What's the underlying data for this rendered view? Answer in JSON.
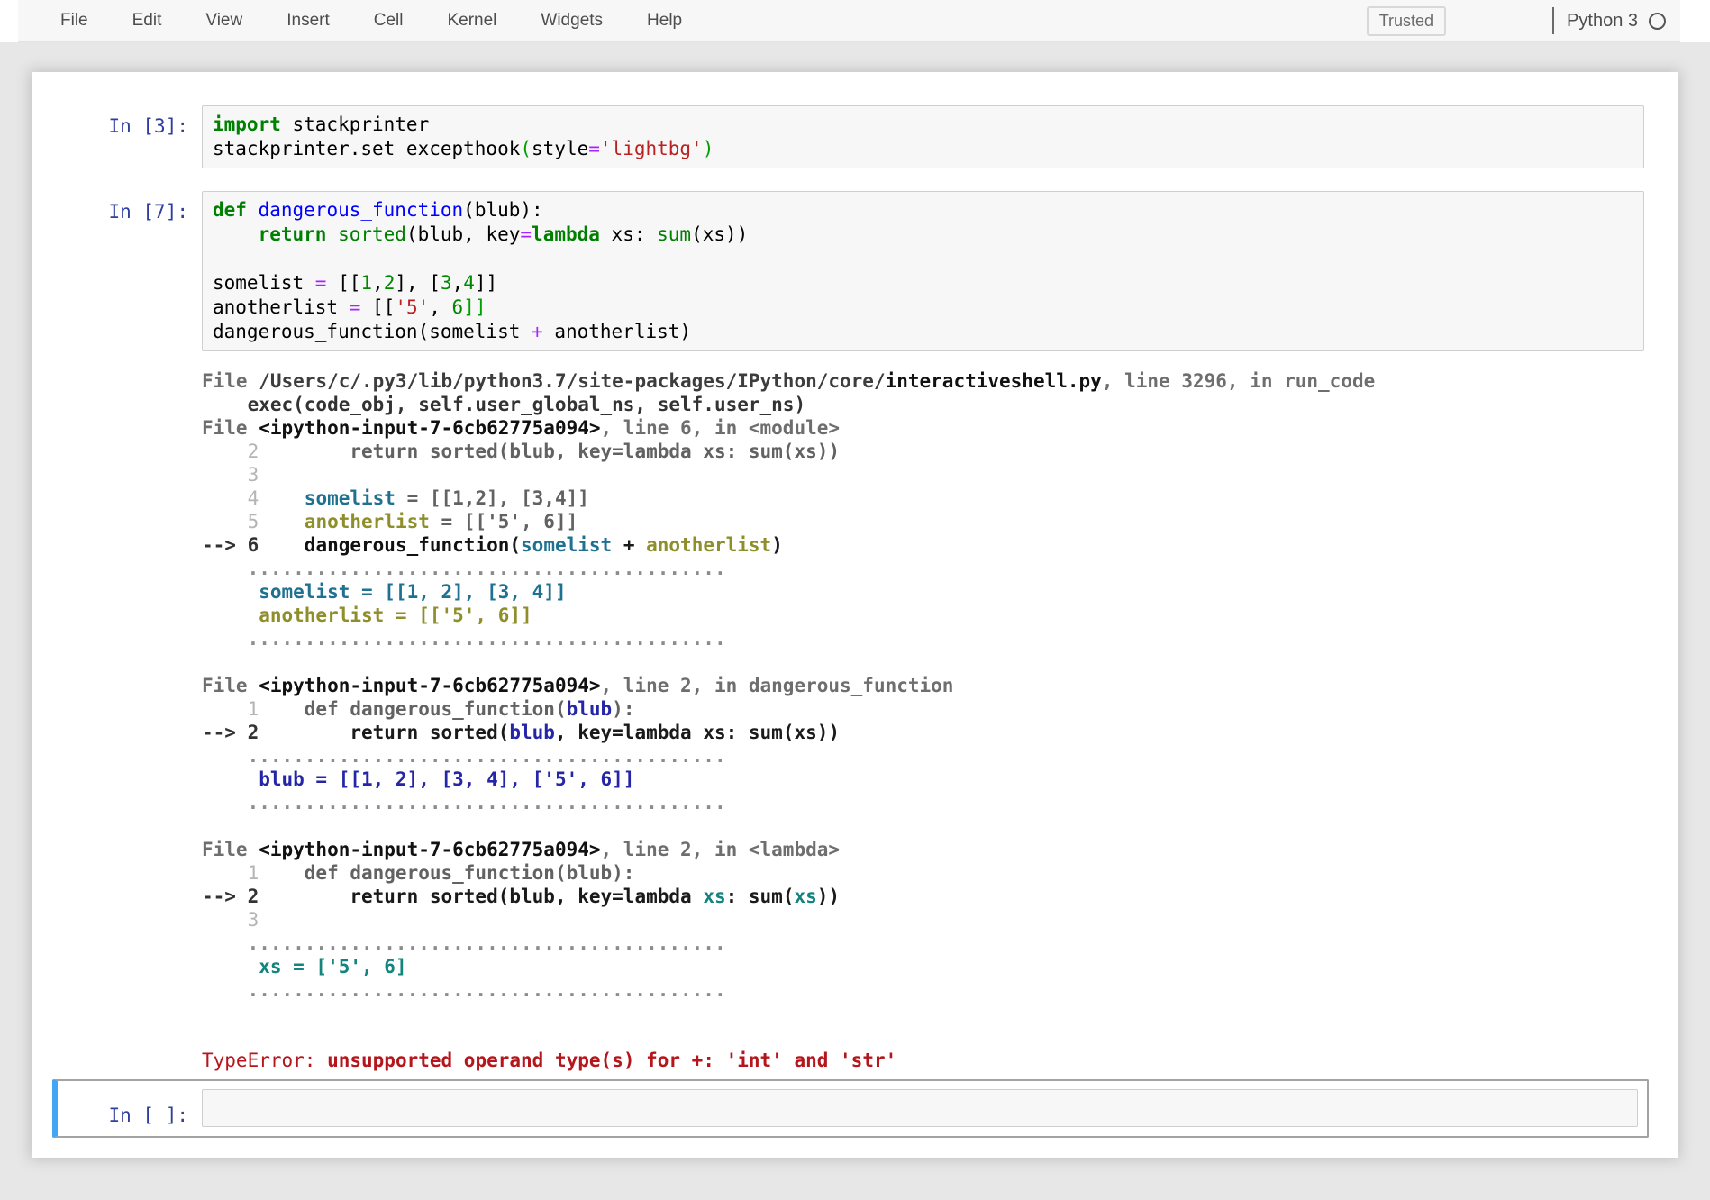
{
  "menu": {
    "items": [
      {
        "label": "File"
      },
      {
        "label": "Edit"
      },
      {
        "label": "View"
      },
      {
        "label": "Insert"
      },
      {
        "label": "Cell"
      },
      {
        "label": "Kernel"
      },
      {
        "label": "Widgets"
      },
      {
        "label": "Help"
      }
    ],
    "trusted_label": "Trusted",
    "kernel_name": "Python 3",
    "kernel_status_icon": "idle-circle-icon"
  },
  "colors": {
    "prompt_blue": "#303F9F",
    "selected_cell_bar": "#42A5F5",
    "keyword_green": "#008000",
    "string_red": "#ba2121",
    "operator_purple": "#aa22ff",
    "error_red": "#b4161c",
    "var_somelist_teal": "#1f7191",
    "var_anotherlist_olive": "#8e8e2a",
    "var_blub_navy": "#2525a8",
    "var_xs_teal": "#13847e",
    "cell_bg": "#f7f7f7",
    "page_bg": "#e7e7e7"
  },
  "cells": [
    {
      "prompt": "In [3]:",
      "segments": [
        {
          "t": "import",
          "c": "kw"
        },
        {
          "t": " stackprinter\nstackprinter.set_excepthook",
          "c": "pl"
        },
        {
          "t": "(",
          "c": "mb"
        },
        {
          "t": "style",
          "c": "pl"
        },
        {
          "t": "=",
          "c": "op"
        },
        {
          "t": "'lightbg'",
          "c": "str"
        },
        {
          "t": ")",
          "c": "mb"
        }
      ]
    },
    {
      "prompt": "In [7]:",
      "segments": [
        {
          "t": "def",
          "c": "kw"
        },
        {
          "t": " ",
          "c": "pl"
        },
        {
          "t": "dangerous_function",
          "c": "def"
        },
        {
          "t": "(blub):\n    ",
          "c": "pl"
        },
        {
          "t": "return",
          "c": "kw"
        },
        {
          "t": " ",
          "c": "pl"
        },
        {
          "t": "sorted",
          "c": "bi"
        },
        {
          "t": "(blub, key",
          "c": "pl"
        },
        {
          "t": "=",
          "c": "op"
        },
        {
          "t": "lambda",
          "c": "kw"
        },
        {
          "t": " xs: ",
          "c": "pl"
        },
        {
          "t": "sum",
          "c": "bi"
        },
        {
          "t": "(xs))\n\nsomelist ",
          "c": "pl"
        },
        {
          "t": "=",
          "c": "op"
        },
        {
          "t": " [[",
          "c": "pl"
        },
        {
          "t": "1",
          "c": "num"
        },
        {
          "t": ",",
          "c": "pl"
        },
        {
          "t": "2",
          "c": "num"
        },
        {
          "t": "], [",
          "c": "pl"
        },
        {
          "t": "3",
          "c": "num"
        },
        {
          "t": ",",
          "c": "pl"
        },
        {
          "t": "4",
          "c": "num"
        },
        {
          "t": "]]\nanotherlist ",
          "c": "pl"
        },
        {
          "t": "=",
          "c": "op"
        },
        {
          "t": " [[",
          "c": "pl"
        },
        {
          "t": "'5'",
          "c": "str"
        },
        {
          "t": ", ",
          "c": "pl"
        },
        {
          "t": "6",
          "c": "num"
        },
        {
          "t": "]]",
          "c": "mb"
        },
        {
          "t": "\ndangerous_function(somelist ",
          "c": "pl"
        },
        {
          "t": "+",
          "c": "op"
        },
        {
          "t": " anotherlist)",
          "c": "pl"
        }
      ]
    }
  ],
  "output": {
    "segments": [
      {
        "t": "File ",
        "c": "m"
      },
      {
        "t": "/Users/c/.py3/lib/python3.7/site-packages/IPython/core/",
        "c": "path"
      },
      {
        "t": "interactiveshell.py",
        "c": "f"
      },
      {
        "t": ", line 3296, in run_code\n",
        "c": "m"
      },
      {
        "t": "    exec(code_obj, self.user_global_ns, self.user_ns)\n",
        "c": "sl"
      },
      {
        "t": "File ",
        "c": "m"
      },
      {
        "t": "<ipython-input-7-6cb62775a094>",
        "c": "f"
      },
      {
        "t": ", line 6, in <module>\n",
        "c": "m"
      },
      {
        "t": "    2",
        "c": "lno"
      },
      {
        "t": "        return sorted(blub, key=lambda xs: sum(xs))\n",
        "c": "dim"
      },
      {
        "t": "    3\n",
        "c": "lno"
      },
      {
        "t": "    4",
        "c": "lno"
      },
      {
        "t": "    ",
        "c": "dim"
      },
      {
        "t": "somelist",
        "c": "vs"
      },
      {
        "t": " = [[1,2], [3,4]]\n",
        "c": "dim"
      },
      {
        "t": "    5",
        "c": "lno"
      },
      {
        "t": "    ",
        "c": "dim"
      },
      {
        "t": "anotherlist",
        "c": "va"
      },
      {
        "t": " = [['5', 6]]\n",
        "c": "dim"
      },
      {
        "t": "--> 6",
        "c": "arr"
      },
      {
        "t": "    ",
        "c": "cp"
      },
      {
        "t": "dangerous_function",
        "c": "cb"
      },
      {
        "t": "(",
        "c": "cp"
      },
      {
        "t": "somelist",
        "c": "vs"
      },
      {
        "t": " + ",
        "c": "cp"
      },
      {
        "t": "anotherlist",
        "c": "va"
      },
      {
        "t": ")\n",
        "c": "cp"
      },
      {
        "t": "    ..........................................\n",
        "c": "dots"
      },
      {
        "t": "     ",
        "c": "cp"
      },
      {
        "t": "somelist = [[1, 2], [3, 4]]",
        "c": "vs"
      },
      {
        "t": "\n     ",
        "c": "cp"
      },
      {
        "t": "anotherlist = [['5', 6]]",
        "c": "va"
      },
      {
        "t": "\n",
        "c": "cp"
      },
      {
        "t": "    ..........................................\n",
        "c": "dots"
      },
      {
        "t": "\n",
        "c": "cp"
      },
      {
        "t": "File ",
        "c": "m"
      },
      {
        "t": "<ipython-input-7-6cb62775a094>",
        "c": "f"
      },
      {
        "t": ", line 2, in dangerous_function\n",
        "c": "m"
      },
      {
        "t": "    1",
        "c": "lno"
      },
      {
        "t": "    def dangerous_function(",
        "c": "dim"
      },
      {
        "t": "blub",
        "c": "vb"
      },
      {
        "t": "):\n",
        "c": "dim"
      },
      {
        "t": "--> 2",
        "c": "arr"
      },
      {
        "t": "        return sorted(",
        "c": "cp"
      },
      {
        "t": "blub",
        "c": "vb"
      },
      {
        "t": ", key=lambda xs: sum(xs))\n",
        "c": "cp"
      },
      {
        "t": "    ..........................................\n",
        "c": "dots"
      },
      {
        "t": "     ",
        "c": "cp"
      },
      {
        "t": "blub = [[1, 2], [3, 4], ['5', 6]]",
        "c": "vb"
      },
      {
        "t": "\n",
        "c": "cp"
      },
      {
        "t": "    ..........................................\n",
        "c": "dots"
      },
      {
        "t": "\n",
        "c": "cp"
      },
      {
        "t": "File ",
        "c": "m"
      },
      {
        "t": "<ipython-input-7-6cb62775a094>",
        "c": "f"
      },
      {
        "t": ", line 2, in <lambda>\n",
        "c": "m"
      },
      {
        "t": "    1",
        "c": "lno"
      },
      {
        "t": "    def dangerous_function(blub):\n",
        "c": "dim"
      },
      {
        "t": "--> 2",
        "c": "arr"
      },
      {
        "t": "        return sorted(blub, key=lambda ",
        "c": "cp"
      },
      {
        "t": "xs",
        "c": "vx"
      },
      {
        "t": ": sum(",
        "c": "cp"
      },
      {
        "t": "xs",
        "c": "vx"
      },
      {
        "t": "))\n",
        "c": "cp"
      },
      {
        "t": "    3\n",
        "c": "lno"
      },
      {
        "t": "    ..........................................\n",
        "c": "dots"
      },
      {
        "t": "     ",
        "c": "cp"
      },
      {
        "t": "xs = ['5', 6]",
        "c": "vx"
      },
      {
        "t": "\n",
        "c": "cp"
      },
      {
        "t": "    ..........................................\n",
        "c": "dots"
      },
      {
        "t": "\n\n",
        "c": "cp"
      },
      {
        "t": "TypeError:",
        "c": "err"
      },
      {
        "t": " ",
        "c": "cp"
      },
      {
        "t": "unsupported operand type(s) for +: 'int' and 'str'",
        "c": "errb"
      }
    ]
  },
  "empty_cell": {
    "prompt": "In [ ]:"
  }
}
